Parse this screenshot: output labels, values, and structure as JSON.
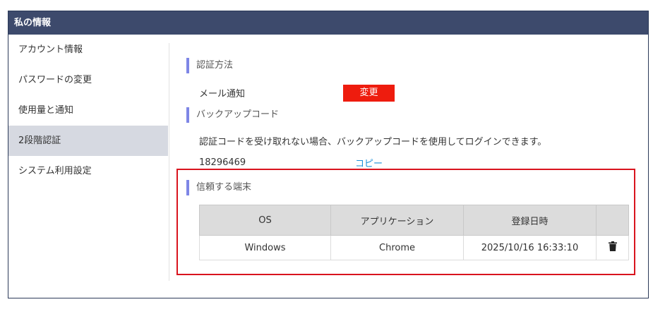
{
  "header": {
    "title": "私の情報"
  },
  "sidebar": {
    "items": [
      {
        "label": "アカウント情報"
      },
      {
        "label": "パスワードの変更"
      },
      {
        "label": "使用量と通知"
      },
      {
        "label": "2段階認証",
        "active": true
      },
      {
        "label": "システム利用設定"
      }
    ]
  },
  "auth": {
    "title": "認証方法",
    "method_label": "メール通知",
    "change_button": "変更"
  },
  "backup": {
    "title": "バックアップコード",
    "description": "認証コードを受け取れない場合、バックアップコードを使用してログインできます。",
    "code": "18296469",
    "copy_link": "コピー"
  },
  "trusted": {
    "title": "信頼する端末",
    "columns": [
      "OS",
      "アプリケーション",
      "登録日時",
      ""
    ],
    "rows": [
      {
        "os": "Windows",
        "app": "Chrome",
        "registered": "2025/10/16 16:33:10",
        "action_icon": "trash-icon"
      }
    ]
  },
  "colors": {
    "header_bg": "#3d4a6c",
    "accent_bar": "#7e86e6",
    "change_button": "#ee1c0e",
    "link": "#1a8fd8",
    "highlight_border": "#d9141e"
  }
}
